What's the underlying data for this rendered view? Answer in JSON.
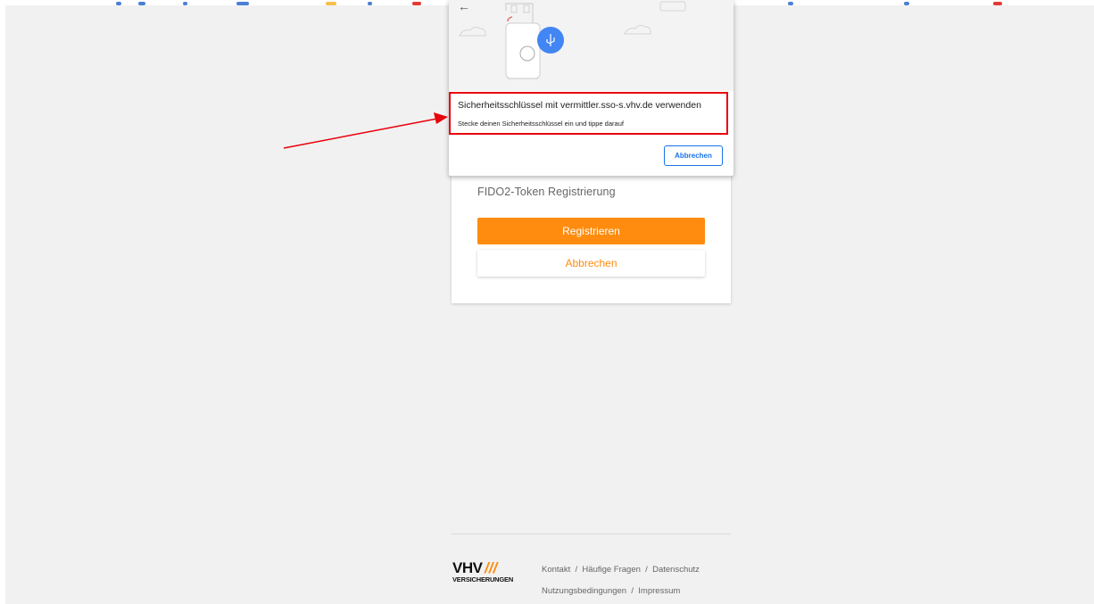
{
  "dialog": {
    "heading": "Sicherheitsschlüssel mit vermittler.sso-s.vhv.de verwenden",
    "subtext": "Stecke deinen Sicherheitsschlüssel ein und tippe darauf",
    "cancel_label": "Abbrechen",
    "back_icon": "arrow-left-icon",
    "illustration_icon": "usb-security-key-icon",
    "accent_color": "#1a73e8"
  },
  "card": {
    "title": "FIDO2-Token Registrierung",
    "register_label": "Registrieren",
    "cancel_label": "Abbrechen",
    "accent_color": "#ff8c0f"
  },
  "footer": {
    "logo_main": "VHV",
    "logo_slashes": "///",
    "logo_sub": "VERSICHERUNGEN",
    "links_row1": [
      "Kontakt",
      "Häufige Fragen",
      "Datenschutz"
    ],
    "links_row2": [
      "Nutzungsbedingungen",
      "Impressum"
    ],
    "separator": "/"
  },
  "annotation": {
    "highlight_color": "#e8000b",
    "arrow_color": "#e8000b"
  }
}
